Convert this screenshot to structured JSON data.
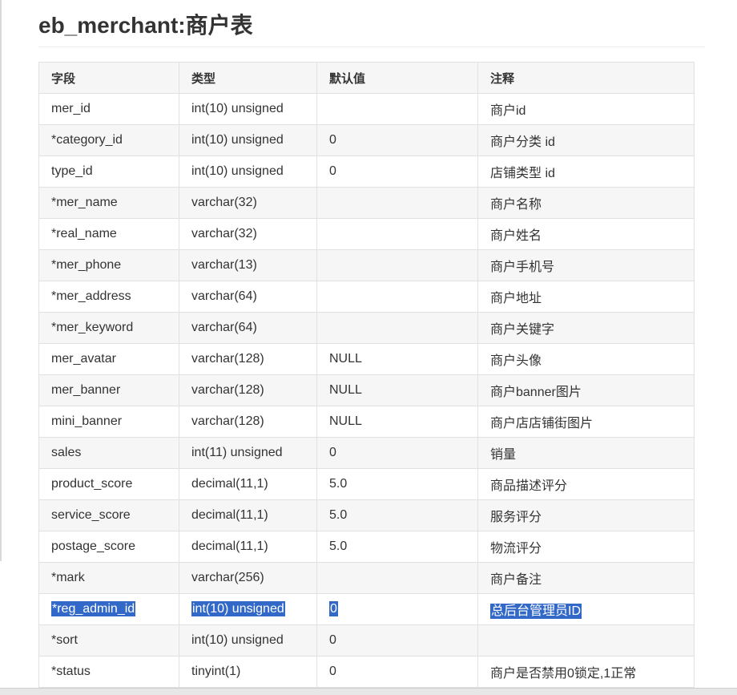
{
  "title": "eb_merchant:商户表",
  "headers": [
    "字段",
    "类型",
    "默认值",
    "注释"
  ],
  "rows": [
    {
      "field": "mer_id",
      "type": "int(10) unsigned",
      "default": "",
      "comment": "商户id"
    },
    {
      "field": "*category_id",
      "type": "int(10) unsigned",
      "default": "0",
      "comment": "商户分类 id"
    },
    {
      "field": "type_id",
      "type": "int(10) unsigned",
      "default": "0",
      "comment": "店铺类型 id"
    },
    {
      "field": "*mer_name",
      "type": "varchar(32)",
      "default": "",
      "comment": "商户名称"
    },
    {
      "field": "*real_name",
      "type": "varchar(32)",
      "default": "",
      "comment": "商户姓名"
    },
    {
      "field": "*mer_phone",
      "type": "varchar(13)",
      "default": "",
      "comment": "商户手机号"
    },
    {
      "field": "*mer_address",
      "type": "varchar(64)",
      "default": "",
      "comment": "商户地址"
    },
    {
      "field": "*mer_keyword",
      "type": "varchar(64)",
      "default": "",
      "comment": "商户关键字"
    },
    {
      "field": "mer_avatar",
      "type": "varchar(128)",
      "default": "NULL",
      "comment": "商户头像"
    },
    {
      "field": "mer_banner",
      "type": "varchar(128)",
      "default": "NULL",
      "comment": "商户banner图片"
    },
    {
      "field": "mini_banner",
      "type": "varchar(128)",
      "default": "NULL",
      "comment": "商户店店铺街图片"
    },
    {
      "field": "sales",
      "type": "int(11) unsigned",
      "default": "0",
      "comment": "销量"
    },
    {
      "field": "product_score",
      "type": "decimal(11,1)",
      "default": "5.0",
      "comment": "商品描述评分"
    },
    {
      "field": "service_score",
      "type": "decimal(11,1)",
      "default": "5.0",
      "comment": "服务评分"
    },
    {
      "field": "postage_score",
      "type": "decimal(11,1)",
      "default": "5.0",
      "comment": "物流评分"
    },
    {
      "field": "*mark",
      "type": "varchar(256)",
      "default": "",
      "comment": "商户备注"
    },
    {
      "field": "*reg_admin_id",
      "type": "int(10) unsigned",
      "default": "0",
      "comment": "总后台管理员ID",
      "selected": true
    },
    {
      "field": "*sort",
      "type": "int(10) unsigned",
      "default": "0",
      "comment": ""
    },
    {
      "field": "*status",
      "type": "tinyint(1)",
      "default": "0",
      "comment": "商户是否禁用0锁定,1正常"
    }
  ]
}
